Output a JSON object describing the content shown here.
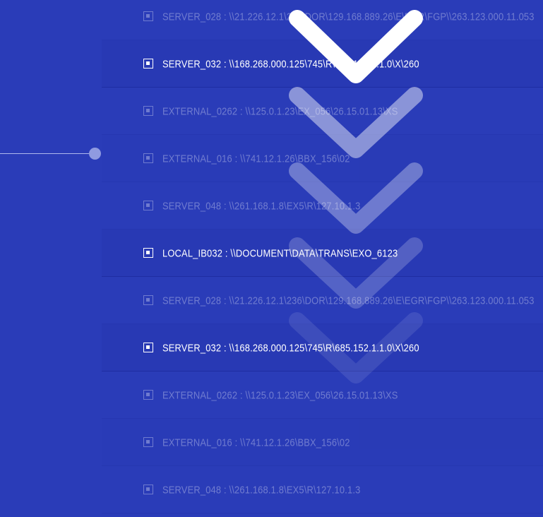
{
  "list": {
    "rows": [
      {
        "name": "SERVER_028",
        "path": "\\\\21.226.12.1\\236\\DOR\\129.168.889.26\\E\\EGR\\FGP\\\\263.123.000.11.053",
        "state": "dim",
        "shade": false
      },
      {
        "name": "SERVER_032",
        "path": "\\\\168.268.000.125\\745\\R\\685.152.1.1.0\\X\\260",
        "state": "bright",
        "shade": true
      },
      {
        "name": "EXTERNAL_0262",
        "path": "\\\\125.0.1.23\\EX_056\\26.15.01.13\\XS",
        "state": "dim",
        "shade": false
      },
      {
        "name": "EXTERNAL_016",
        "path": "\\\\741.12.1.26\\BBX_156\\02",
        "state": "dim",
        "shade": true
      },
      {
        "name": "SERVER_048",
        "path": "\\\\261.168.1.8\\EX5\\R\\127.10.1.3",
        "state": "dim",
        "shade": false
      },
      {
        "name": "LOCAL_IB032",
        "path": "\\\\DOCUMENT\\DATA\\TRANS\\EXO_6123",
        "state": "bright",
        "shade": true
      },
      {
        "name": "SERVER_028",
        "path": "\\\\21.226.12.1\\236\\DOR\\129.168.889.26\\E\\EGR\\FGP\\\\263.123.000.11.053",
        "state": "dim",
        "shade": false
      },
      {
        "name": "SERVER_032",
        "path": "\\\\168.268.000.125\\745\\R\\685.152.1.1.0\\X\\260",
        "state": "bright",
        "shade": true
      },
      {
        "name": "EXTERNAL_0262",
        "path": "\\\\125.0.1.23\\EX_056\\26.15.01.13\\XS",
        "state": "dim",
        "shade": false
      },
      {
        "name": "EXTERNAL_016",
        "path": "\\\\741.12.1.26\\BBX_156\\02",
        "state": "dim",
        "shade": true
      },
      {
        "name": "SERVER_048",
        "path": "\\\\261.168.1.8\\EX5\\R\\127.10.1.3",
        "state": "dim",
        "shade": false
      }
    ]
  },
  "colors": {
    "background": "#2a3cb8",
    "text": "#ffffff",
    "node": "#8f9ae0",
    "chevron": "#ffffff"
  },
  "icons": {
    "row_icon": "checkbox-square-icon",
    "overlay_icon": "chevron-down-icon"
  }
}
